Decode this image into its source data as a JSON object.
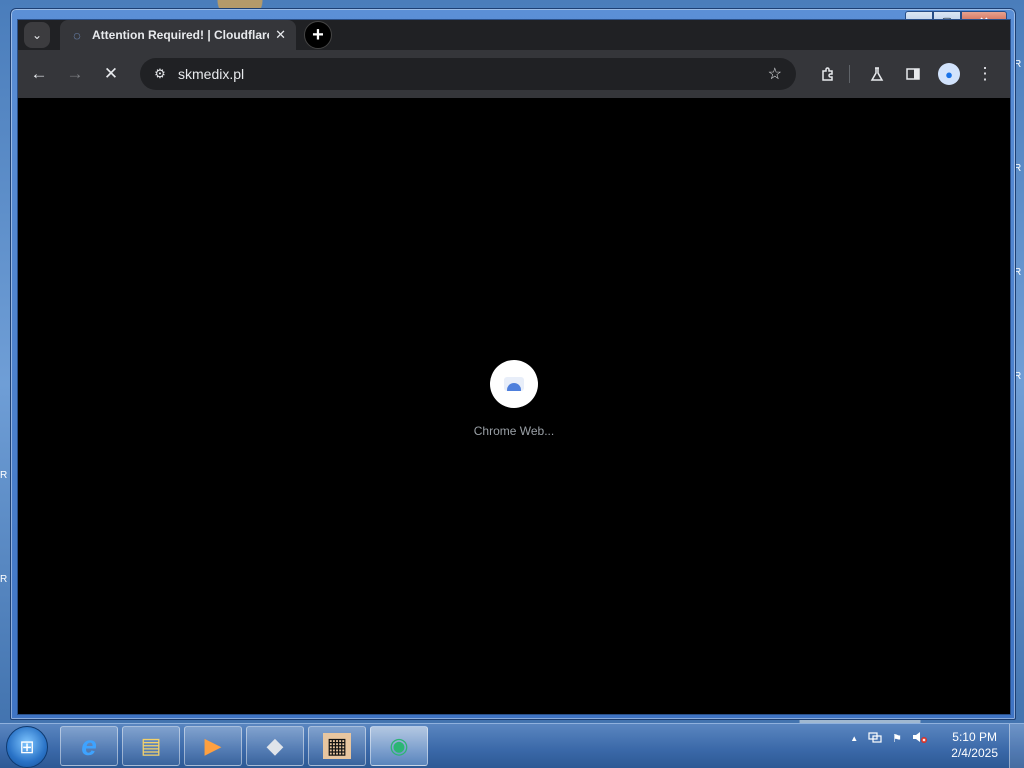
{
  "browser": {
    "tab": {
      "title": "Attention Required! | Cloudflare",
      "favicon": "loading-globe-icon",
      "close": "✕"
    },
    "new_tab": "+",
    "tab_search": "⌄",
    "nav": {
      "back": "←",
      "forward": "→",
      "stop": "✕"
    },
    "omnibox": {
      "url": "skmedix.pl",
      "site_info_icon": "tune-icon",
      "bookmark": "☆"
    },
    "toolbar_icons": {
      "extensions": "extensions-icon",
      "labs": "labs-icon",
      "side_panel": "side-panel-icon",
      "profile": "profile-icon",
      "menu": "⋮"
    },
    "content": {
      "loading_label": "Chrome Web..."
    }
  },
  "window_controls": {
    "minimize": "▁",
    "maximize": "▢",
    "close": "✕"
  },
  "taskbar": {
    "start": "⊞",
    "apps": [
      {
        "name": "internet-explorer",
        "glyph": "e"
      },
      {
        "name": "file-explorer",
        "glyph": "▤"
      },
      {
        "name": "media-player",
        "glyph": "▶"
      },
      {
        "name": "roblox",
        "glyph": "◆"
      },
      {
        "name": "minecraft",
        "glyph": "▦"
      },
      {
        "name": "chrome",
        "glyph": "◉"
      }
    ],
    "tray": {
      "show_hidden": "▲",
      "network": "network-icon",
      "flag": "⚑",
      "volume": "🔇"
    },
    "clock": {
      "time": "5:10 PM",
      "date": "2/4/2025"
    }
  },
  "desktop_edge_letters": [
    "R",
    "R",
    "R",
    "R",
    "R",
    "R"
  ]
}
